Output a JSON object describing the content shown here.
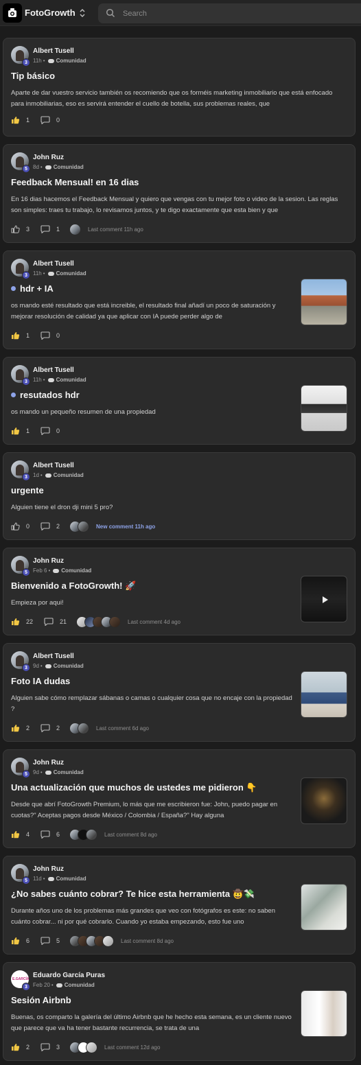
{
  "app": {
    "name": "FotoGrowth"
  },
  "search": {
    "placeholder": "Search"
  },
  "posts": [
    {
      "author": "Albert Tusell",
      "level": "3",
      "time": "11h",
      "category": "Comunidad",
      "title": "Tip básico",
      "excerpt": "Aparte de dar vuestro servicio también os recomiendo que os forméis marketing inmobiliario que está enfocado para inmobiliarias, eso es servirá entender el cuello de botella, sus problemas reales, que",
      "likes": "1",
      "comments": "0",
      "last_comment": ""
    },
    {
      "author": "John Ruz",
      "level": "5",
      "time": "8d",
      "category": "Comunidad",
      "title": "Feedback Mensual! en 16 dias",
      "excerpt": "En 16 dias hacemos el Feedback Mensual y quiero que vengas con tu mejor foto o video de la sesion. Las reglas son simples: traes tu trabajo, lo revisamos juntos, y te digo exactamente que esta bien y que",
      "likes": "3",
      "comments": "1",
      "last_comment": "Last comment 11h ago"
    },
    {
      "author": "Albert Tusell",
      "level": "3",
      "time": "11h",
      "category": "Comunidad",
      "title": "hdr + IA",
      "excerpt": "os mando esté resultado que está increible, el resultado final añadí un poco de saturación y mejorar resolución de calidad ya que aplicar con IA puede perder algo de",
      "likes": "1",
      "comments": "0",
      "last_comment": "",
      "unread": true,
      "thumb": "house-exterior"
    },
    {
      "author": "Albert Tusell",
      "level": "3",
      "time": "11h",
      "category": "Comunidad",
      "title": "resutados hdr",
      "excerpt": "os mando un pequeño resumen de una propiedad",
      "likes": "1",
      "comments": "0",
      "last_comment": "",
      "unread": true,
      "thumb": "kitchen-interior"
    },
    {
      "author": "Albert Tusell",
      "level": "3",
      "time": "1d",
      "category": "Comunidad",
      "title": "urgente",
      "excerpt": "Alguien tiene el dron dji mini 5 pro?",
      "likes": "0",
      "comments": "2",
      "last_comment": "New comment 11h ago",
      "new_comment": true
    },
    {
      "author": "John Ruz",
      "level": "5",
      "time": "Feb 6",
      "category": "Comunidad",
      "title": "Bienvenido a FotoGrowth! 🚀",
      "excerpt": "Empieza por aqui!",
      "likes": "22",
      "comments": "21",
      "last_comment": "Last comment 4d ago",
      "thumb": "video"
    },
    {
      "author": "Albert Tusell",
      "level": "3",
      "time": "9d",
      "category": "Comunidad",
      "title": "Foto IA dudas",
      "excerpt": "Alguien sabe cómo remplazar sábanas o camas o cualquier cosa que no encaje con la propiedad ?",
      "likes": "2",
      "comments": "2",
      "last_comment": "Last comment 6d ago",
      "thumb": "bedroom"
    },
    {
      "author": "John Ruz",
      "level": "5",
      "time": "9d",
      "category": "Comunidad",
      "title": "Una actualización que muchos de ustedes me pidieron 👇",
      "excerpt": "Desde que abrí FotoGrowth Premium, lo más que me escribieron fue: John, puedo pagar en cuotas?\" Aceptas pagos desde México / Colombia / España?\" Hay alguna",
      "likes": "4",
      "comments": "6",
      "last_comment": "Last comment 8d ago",
      "thumb": "portrait"
    },
    {
      "author": "John Ruz",
      "level": "5",
      "time": "11d",
      "category": "Comunidad",
      "title": "¿No sabes cuánto cobrar? Te hice esta herramienta 🤠💸",
      "excerpt": "Durante años uno de los problemas más grandes que veo con fotógrafos es este: no saben cuánto cobrar... ni por qué cobrarlo. Cuando yo estaba empezando, esto fue uno",
      "likes": "6",
      "comments": "5",
      "last_comment": "Last comment 8d ago",
      "thumb": "money"
    },
    {
      "author": "Eduardo García Puras",
      "level": "3",
      "time": "Feb 20",
      "category": "Comunidad",
      "title": "Sesión Airbnb",
      "excerpt": "Buenas, os comparto la galería del último Airbnb que he hecho esta semana, es un cliente nuevo que parece que va ha tener bastante recurrencia, se trata de una",
      "likes": "2",
      "comments": "3",
      "last_comment": "Last comment 12d ago",
      "thumb": "interior-white"
    }
  ]
}
